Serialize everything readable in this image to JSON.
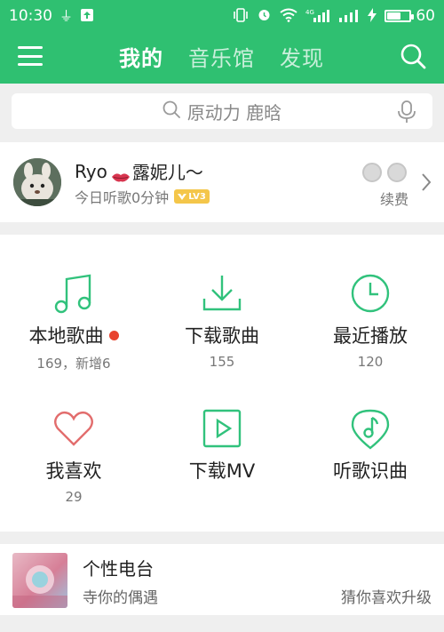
{
  "status_bar": {
    "time": "10:30",
    "battery": "60",
    "signal_label": "4G",
    "battery_level": 0.6
  },
  "nav": {
    "tabs": [
      {
        "label": "我的",
        "active": true
      },
      {
        "label": "音乐馆",
        "active": false
      },
      {
        "label": "发现",
        "active": false
      }
    ]
  },
  "search": {
    "placeholder": "原动力 鹿晗"
  },
  "profile": {
    "name": "Ryo",
    "name_suffix": "露妮儿～",
    "listen_time": "今日听歌0分钟",
    "level": "LV3",
    "renew_label": "续费"
  },
  "grid": [
    {
      "label": "本地歌曲",
      "count": "169，新增6",
      "icon": "music-note-icon",
      "has_dot": true
    },
    {
      "label": "下载歌曲",
      "count": "155",
      "icon": "download-icon"
    },
    {
      "label": "最近播放",
      "count": "120",
      "icon": "clock-icon"
    },
    {
      "label": "我喜欢",
      "count": "29",
      "icon": "heart-icon"
    },
    {
      "label": "下载MV",
      "count": "",
      "icon": "play-square-icon"
    },
    {
      "label": "听歌识曲",
      "count": "",
      "icon": "music-recognize-icon"
    }
  ],
  "radio": {
    "title": "个性电台",
    "left_sub": "寺你的偶遇",
    "right_sub": "猜你喜欢升级"
  },
  "colors": {
    "brand_green": "#2fc071",
    "icon_green": "#31c27c",
    "heart_red": "#e26d6d",
    "dot_red": "#e8432f"
  }
}
